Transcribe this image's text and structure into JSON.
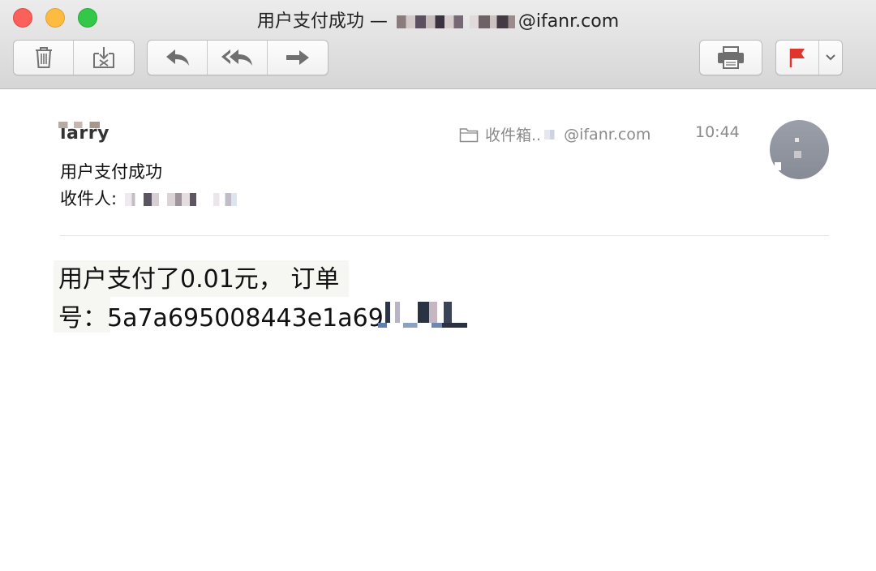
{
  "window": {
    "title_prefix": "用户支付成功 — ",
    "title_suffix": "@ifanr.com"
  },
  "toolbar": {
    "buttons": [
      {
        "name": "delete",
        "icon": "trash-icon"
      },
      {
        "name": "junk",
        "icon": "junk-icon"
      },
      {
        "name": "reply",
        "icon": "reply-icon"
      },
      {
        "name": "reply-all",
        "icon": "reply-all-icon"
      },
      {
        "name": "forward",
        "icon": "forward-icon"
      },
      {
        "name": "print",
        "icon": "printer-icon"
      },
      {
        "name": "flag",
        "icon": "flag-icon"
      },
      {
        "name": "flag-menu",
        "icon": "chevron-down-icon"
      }
    ],
    "flag_color": "#e0352c"
  },
  "header": {
    "sender": "larry",
    "mailbox_label": "收件箱..",
    "mailbox_account": "@ifanr.com",
    "time": "10:44",
    "subject": "用户支付成功",
    "recipient_label": "收件人:"
  },
  "body": {
    "line1": "用户支付了0.01元， 订单",
    "line2": "号：5a7a695008443e1a69"
  }
}
